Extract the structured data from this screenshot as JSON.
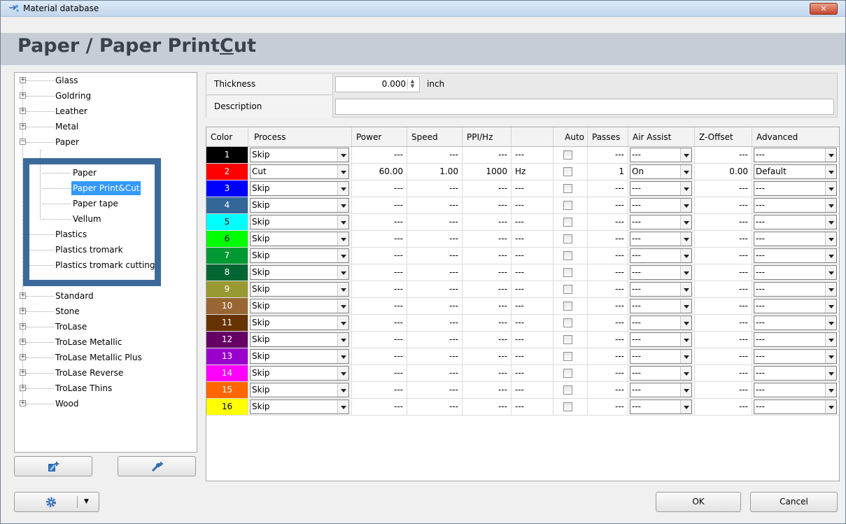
{
  "window": {
    "title": "Material database",
    "close_label": "✕",
    "heading_prefix": "Paper / Paper Print",
    "heading_underlined": "C",
    "heading_suffix": "ut"
  },
  "tree": {
    "items": [
      {
        "label": "Glass",
        "expandable": true,
        "level": 0
      },
      {
        "label": "Goldring",
        "expandable": true,
        "level": 0
      },
      {
        "label": "Leather",
        "expandable": true,
        "level": 0
      },
      {
        "label": "Metal",
        "expandable": true,
        "level": 0
      },
      {
        "label": "Paper",
        "expandable": true,
        "expanded": true,
        "level": 0
      },
      {
        "label": "Paper",
        "level": 1
      },
      {
        "label": "Paper Print&Cut",
        "level": 1,
        "selected": true
      },
      {
        "label": "Paper tape",
        "level": 1
      },
      {
        "label": "Vellum",
        "level": 1
      },
      {
        "label": "Plastics",
        "level": 0
      },
      {
        "label": "Plastics tromark",
        "level": 0
      },
      {
        "label": "Plastics tromark cutting",
        "level": 0
      },
      {
        "label": "Standard",
        "expandable": true,
        "level": 0
      },
      {
        "label": "Stone",
        "expandable": true,
        "level": 0
      },
      {
        "label": "TroLase",
        "expandable": true,
        "level": 0
      },
      {
        "label": "TroLase Metallic",
        "expandable": true,
        "level": 0
      },
      {
        "label": "TroLase Metallic Plus",
        "expandable": true,
        "level": 0
      },
      {
        "label": "TroLase Reverse",
        "expandable": true,
        "level": 0
      },
      {
        "label": "TroLase Thins",
        "expandable": true,
        "level": 0
      },
      {
        "label": "Wood",
        "expandable": true,
        "level": 0
      }
    ]
  },
  "props": {
    "thickness_label": "Thickness",
    "thickness_value": "0.000",
    "thickness_unit": "inch",
    "description_label": "Description",
    "description_value": ""
  },
  "grid": {
    "headers": {
      "color": "Color",
      "process": "Process",
      "power": "Power",
      "speed": "Speed",
      "ppi": "PPI/Hz",
      "unit": "",
      "auto": "Auto",
      "passes": "Passes",
      "air": "Air Assist",
      "z": "Z-Offset",
      "advanced": "Advanced"
    },
    "rows": [
      {
        "n": "1",
        "color": "#000000",
        "fg": "#ffffff",
        "process": "Skip",
        "power": "---",
        "speed": "---",
        "ppi": "---",
        "unit": "---",
        "passes": "---",
        "air": "---",
        "z": "---",
        "adv": "---"
      },
      {
        "n": "2",
        "color": "#ff0000",
        "fg": "#ffffff",
        "process": "Cut",
        "power": "60.00",
        "speed": "1.00",
        "ppi": "1000",
        "unit": "Hz",
        "passes": "1",
        "air": "On",
        "z": "0.00",
        "adv": "Default"
      },
      {
        "n": "3",
        "color": "#0000ff",
        "fg": "#ffffff",
        "process": "Skip",
        "power": "---",
        "speed": "---",
        "ppi": "---",
        "unit": "---",
        "passes": "---",
        "air": "---",
        "z": "---",
        "adv": "---"
      },
      {
        "n": "4",
        "color": "#336699",
        "fg": "#ffffff",
        "process": "Skip",
        "power": "---",
        "speed": "---",
        "ppi": "---",
        "unit": "---",
        "passes": "---",
        "air": "---",
        "z": "---",
        "adv": "---"
      },
      {
        "n": "5",
        "color": "#00ffff",
        "fg": "#000000",
        "process": "Skip",
        "power": "---",
        "speed": "---",
        "ppi": "---",
        "unit": "---",
        "passes": "---",
        "air": "---",
        "z": "---",
        "adv": "---"
      },
      {
        "n": "6",
        "color": "#00ff00",
        "fg": "#000000",
        "process": "Skip",
        "power": "---",
        "speed": "---",
        "ppi": "---",
        "unit": "---",
        "passes": "---",
        "air": "---",
        "z": "---",
        "adv": "---"
      },
      {
        "n": "7",
        "color": "#009933",
        "fg": "#ffffff",
        "process": "Skip",
        "power": "---",
        "speed": "---",
        "ppi": "---",
        "unit": "---",
        "passes": "---",
        "air": "---",
        "z": "---",
        "adv": "---"
      },
      {
        "n": "8",
        "color": "#006633",
        "fg": "#ffffff",
        "process": "Skip",
        "power": "---",
        "speed": "---",
        "ppi": "---",
        "unit": "---",
        "passes": "---",
        "air": "---",
        "z": "---",
        "adv": "---"
      },
      {
        "n": "9",
        "color": "#999933",
        "fg": "#ffffff",
        "process": "Skip",
        "power": "---",
        "speed": "---",
        "ppi": "---",
        "unit": "---",
        "passes": "---",
        "air": "---",
        "z": "---",
        "adv": "---"
      },
      {
        "n": "10",
        "color": "#996633",
        "fg": "#ffffff",
        "process": "Skip",
        "power": "---",
        "speed": "---",
        "ppi": "---",
        "unit": "---",
        "passes": "---",
        "air": "---",
        "z": "---",
        "adv": "---"
      },
      {
        "n": "11",
        "color": "#663300",
        "fg": "#ffffff",
        "process": "Skip",
        "power": "---",
        "speed": "---",
        "ppi": "---",
        "unit": "---",
        "passes": "---",
        "air": "---",
        "z": "---",
        "adv": "---"
      },
      {
        "n": "12",
        "color": "#660066",
        "fg": "#ffffff",
        "process": "Skip",
        "power": "---",
        "speed": "---",
        "ppi": "---",
        "unit": "---",
        "passes": "---",
        "air": "---",
        "z": "---",
        "adv": "---"
      },
      {
        "n": "13",
        "color": "#9900cc",
        "fg": "#ffffff",
        "process": "Skip",
        "power": "---",
        "speed": "---",
        "ppi": "---",
        "unit": "---",
        "passes": "---",
        "air": "---",
        "z": "---",
        "adv": "---"
      },
      {
        "n": "14",
        "color": "#ff00ff",
        "fg": "#ffffff",
        "process": "Skip",
        "power": "---",
        "speed": "---",
        "ppi": "---",
        "unit": "---",
        "passes": "---",
        "air": "---",
        "z": "---",
        "adv": "---"
      },
      {
        "n": "15",
        "color": "#ff6600",
        "fg": "#ffffff",
        "process": "Skip",
        "power": "---",
        "speed": "---",
        "ppi": "---",
        "unit": "---",
        "passes": "---",
        "air": "---",
        "z": "---",
        "adv": "---"
      },
      {
        "n": "16",
        "color": "#ffff00",
        "fg": "#000000",
        "process": "Skip",
        "power": "---",
        "speed": "---",
        "ppi": "---",
        "unit": "---",
        "passes": "---",
        "air": "---",
        "z": "---",
        "adv": "---"
      }
    ]
  },
  "buttons": {
    "ok": "OK",
    "cancel": "Cancel",
    "add_material_icon": "add-material-icon",
    "add_process_icon": "add-process-icon",
    "settings_icon": "gear-icon"
  }
}
